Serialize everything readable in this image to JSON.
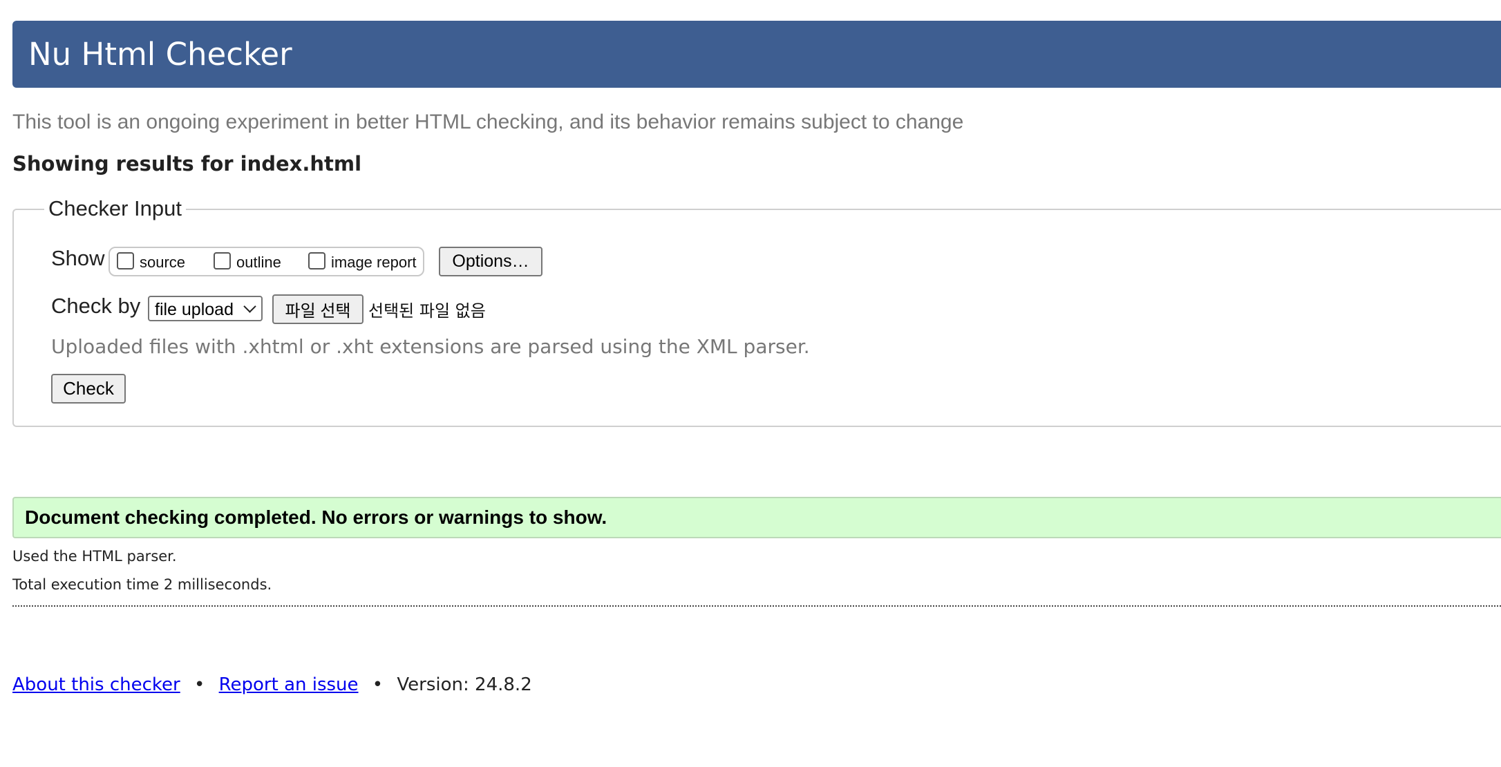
{
  "header": {
    "title": "Nu Html Checker"
  },
  "tagline": "This tool is an ongoing experiment in better HTML checking, and its behavior remains subject to change",
  "results_heading": "Showing results for index.html",
  "checker_input": {
    "legend": "Checker Input",
    "show_label": "Show",
    "show_options": [
      {
        "label": "source",
        "checked": false
      },
      {
        "label": "outline",
        "checked": false
      },
      {
        "label": "image report",
        "checked": false
      }
    ],
    "options_button": "Options…",
    "check_by_label": "Check by",
    "check_by_selected": "file upload",
    "file_button": "파일 선택",
    "file_status": "선택된 파일 없음",
    "hint": "Uploaded files with .xhtml or .xht extensions are parsed using the XML parser.",
    "check_button": "Check"
  },
  "results": {
    "success_message": "Document checking completed. No errors or warnings to show.",
    "parser_info": "Used the HTML parser.",
    "execution_time": "Total execution time 2 milliseconds."
  },
  "footer": {
    "about_link": "About this checker",
    "separator": "•",
    "report_link": "Report an issue",
    "version": "Version: 24.8.2"
  },
  "colors": {
    "banner": "#3e5e91",
    "success_bg": "#d5fdd1",
    "link": "#0000ee"
  }
}
